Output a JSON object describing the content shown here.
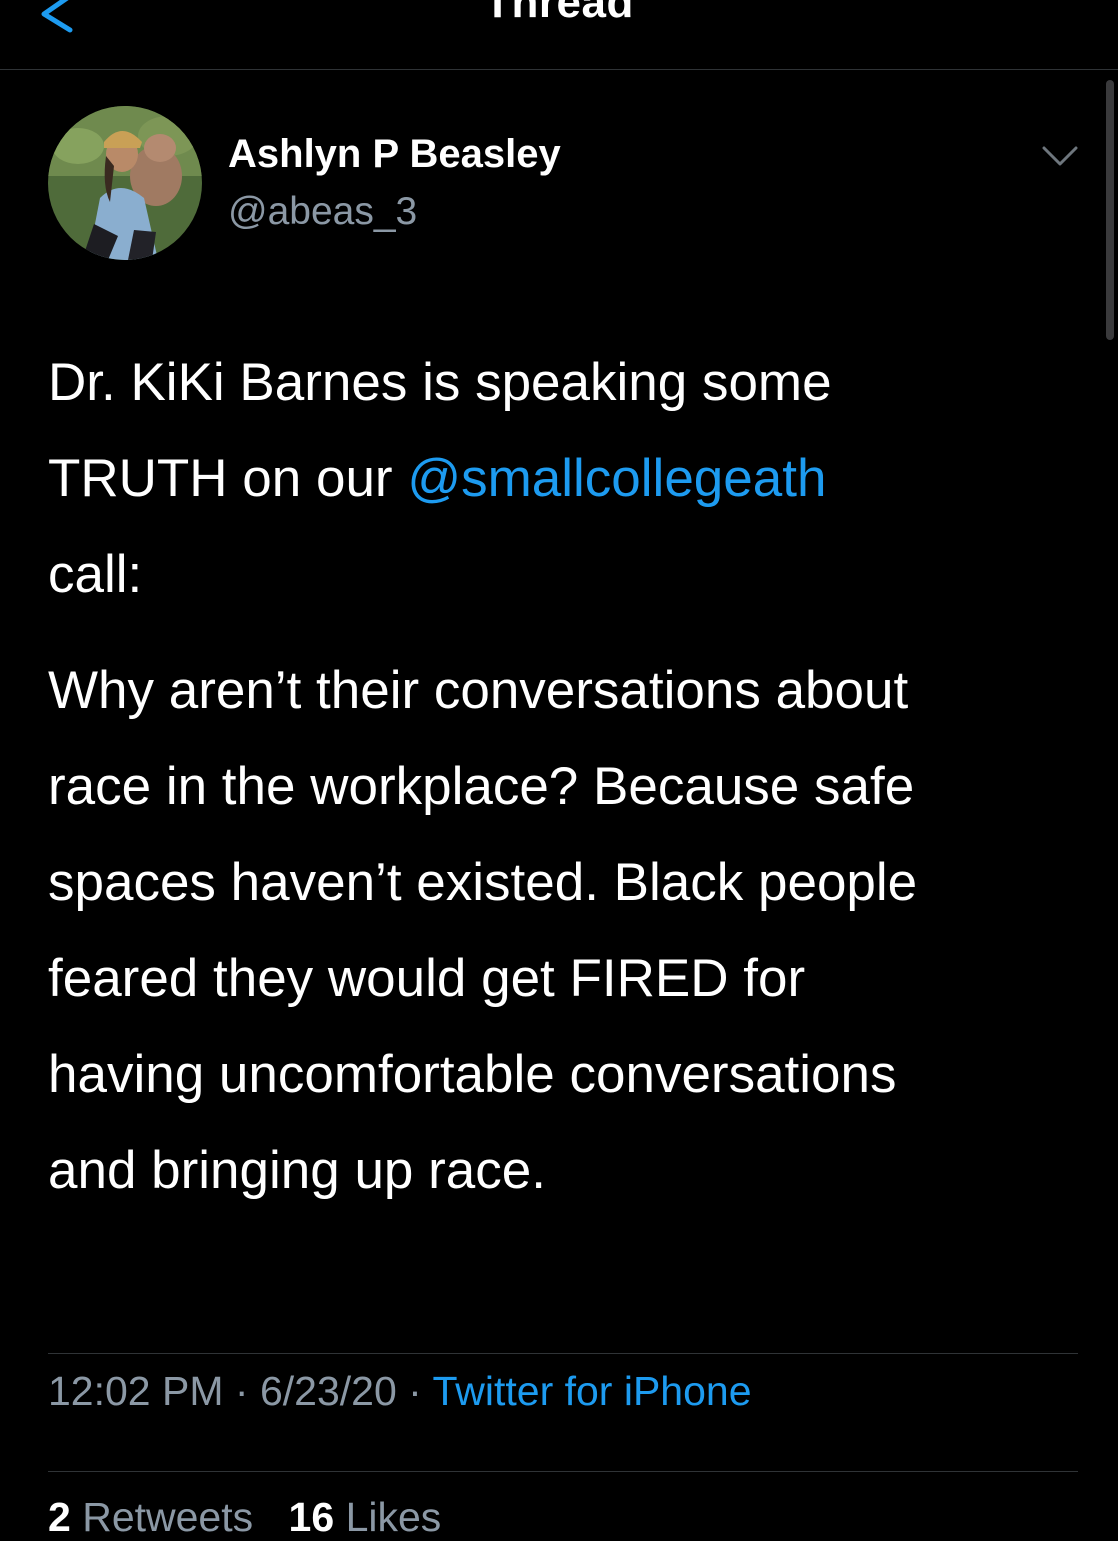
{
  "nav": {
    "title": "Thread",
    "back_icon": "chevron-left-icon"
  },
  "tweet": {
    "author": {
      "name": "Ashlyn P Beasley",
      "handle": "@abeas_3",
      "avatar": "profile-photo"
    },
    "more_icon": "chevron-down-icon",
    "body": {
      "line1": "Dr. KiKi Barnes is speaking some",
      "line2_pre": "TRUTH on our ",
      "mention": "@smallcollegeath",
      "line3": "call:",
      "para2_lines": [
        "Why aren’t their conversations about",
        "race in the workplace? Because safe",
        "spaces haven’t existed. Black people",
        "feared they would get FIRED for",
        "having uncomfortable conversations",
        "and bringing up race."
      ]
    },
    "meta": {
      "time": "12:02 PM",
      "separator": "·",
      "date": "6/23/20",
      "source": "Twitter for iPhone"
    },
    "stats": {
      "retweets_count": "2",
      "retweets_label": "Retweets",
      "likes_count": "16",
      "likes_label": "Likes"
    }
  },
  "colors": {
    "background": "#000000",
    "accent": "#1d9bf0",
    "secondary_text": "#8b98a5",
    "divider": "#2f3336"
  }
}
